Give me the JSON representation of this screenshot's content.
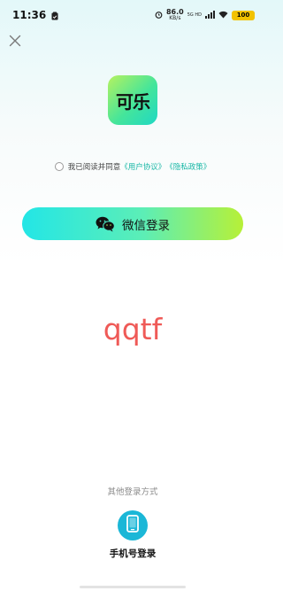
{
  "status_bar": {
    "time": "11:36",
    "net_speed_value": "86.0",
    "net_speed_unit": "KB/s",
    "signal_text": "5G HD",
    "battery": "100"
  },
  "header": {
    "close_icon": "close-icon"
  },
  "logo": {
    "text": "可乐"
  },
  "agreement": {
    "prefix": "我已阅读并同意",
    "user_agreement": "《用户协议》",
    "privacy_policy": "《隐私政策》",
    "checked": false
  },
  "wechat_login": {
    "label": "微信登录",
    "icon": "wechat-icon"
  },
  "watermark": {
    "text": "qqtf"
  },
  "other_login": {
    "title": "其他登录方式",
    "phone_label": "手机号登录",
    "phone_icon": "mobile-phone-icon"
  },
  "colors": {
    "accent_teal": "#18b7a6",
    "button_gradient_start": "#23e6e6",
    "button_gradient_end": "#b7f037",
    "watermark_red": "#ef5a57",
    "phone_button": "#1bb7d7"
  }
}
